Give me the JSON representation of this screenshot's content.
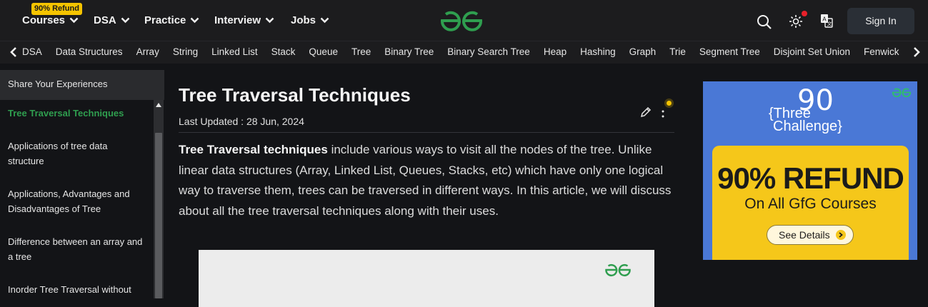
{
  "nav": {
    "refund_badge": "90% Refund",
    "items": [
      {
        "label": "Courses"
      },
      {
        "label": "DSA"
      },
      {
        "label": "Practice"
      },
      {
        "label": "Interview"
      },
      {
        "label": "Jobs"
      }
    ],
    "signin_label": "Sign In",
    "logo_icon": "gfg-logo",
    "search_icon": "search-icon",
    "theme_icon": "sun-icon",
    "translate_icon": "translate-icon"
  },
  "topics": {
    "items": [
      "DSA",
      "Data Structures",
      "Array",
      "String",
      "Linked List",
      "Stack",
      "Queue",
      "Tree",
      "Binary Tree",
      "Binary Search Tree",
      "Heap",
      "Hashing",
      "Graph",
      "Trie",
      "Segment Tree",
      "Disjoint Set Union",
      "Fenwick"
    ]
  },
  "sidebar": {
    "top_item": "Share Your Experiences",
    "items": [
      {
        "label": "Tree Traversal Techniques",
        "active": true
      },
      {
        "label": "Applications of tree data structure",
        "active": false
      },
      {
        "label": "Applications, Advantages and Disadvantages of Tree",
        "active": false
      },
      {
        "label": "Difference between an array and a tree",
        "active": false
      },
      {
        "label": "Inorder Tree Traversal without",
        "active": false
      }
    ]
  },
  "article": {
    "title": "Tree Traversal Techniques",
    "updated": "Last Updated : 28 Jun, 2024",
    "intro_bold": "Tree Traversal techniques",
    "intro_rest": " include various ways to visit all the nodes of the tree. Unlike linear data structures (Array, Linked List, Queues, Stacks, etc) which have only one logical way to traverse them, trees can be traversed in different ways. In this article, we will discuss about all the tree traversal techniques along with their uses."
  },
  "ad": {
    "three": "{Three",
    "ninety": "90",
    "challenge": "Challenge}",
    "refund": "90% REFUND",
    "subtitle": "On All GfG Courses",
    "button": "See Details"
  },
  "colors": {
    "brand_green": "#2f9e4f",
    "badge_yellow": "#f5c400",
    "ad_blue": "#4a78d6"
  }
}
